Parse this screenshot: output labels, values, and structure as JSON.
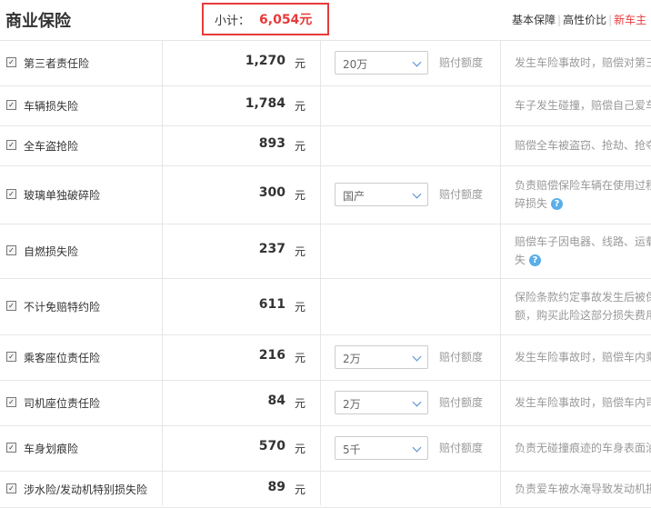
{
  "header": {
    "title": "商业保险",
    "subtotal_label": "小计：",
    "subtotal_value": "6,054元",
    "tabs": [
      "基本保障",
      "高性价比",
      "新车主"
    ],
    "tab_sep": "|"
  },
  "unit": "元",
  "pay_label": "赔付额度",
  "check_mark": "✓",
  "rows": [
    {
      "name": "第三者责任险",
      "price": "1,270",
      "select": "20万",
      "desc": [
        "发生车险事故时，赔偿对第三"
      ]
    },
    {
      "name": "车辆损失险",
      "price": "1,784",
      "select": null,
      "desc": [
        "车子发生碰撞，赔偿自己爱车"
      ]
    },
    {
      "name": "全车盗抢险",
      "price": "893",
      "select": null,
      "desc": [
        "赔偿全车被盗窃、抢劫、抢夺"
      ]
    },
    {
      "name": "玻璃单独破碎险",
      "price": "300",
      "select": "国产",
      "desc": [
        "负责赔偿保险车辆在使用过程",
        "碎损失"
      ]
    },
    {
      "name": "自燃损失险",
      "price": "237",
      "select": null,
      "desc": [
        "赔偿车子因电器、线路、运载",
        "失"
      ]
    },
    {
      "name": "不计免赔特约险",
      "price": "611",
      "select": null,
      "desc": [
        "保险条款约定事故发生后被保",
        "额，购买此险这部分损失费用"
      ]
    },
    {
      "name": "乘客座位责任险",
      "price": "216",
      "select": "2万",
      "desc": [
        "发生车险事故时，赔偿车内乘"
      ]
    },
    {
      "name": "司机座位责任险",
      "price": "84",
      "select": "2万",
      "desc": [
        "发生车险事故时，赔偿车内司"
      ]
    },
    {
      "name": "车身划痕险",
      "price": "570",
      "select": "5千",
      "desc": [
        "负责无碰撞痕迹的车身表面油"
      ]
    },
    {
      "name": "涉水险/发动机特别损失险",
      "price": "89",
      "select": null,
      "desc": [
        "负责爱车被水淹导致发动机损"
      ]
    }
  ],
  "help_icon_glyph": "?"
}
